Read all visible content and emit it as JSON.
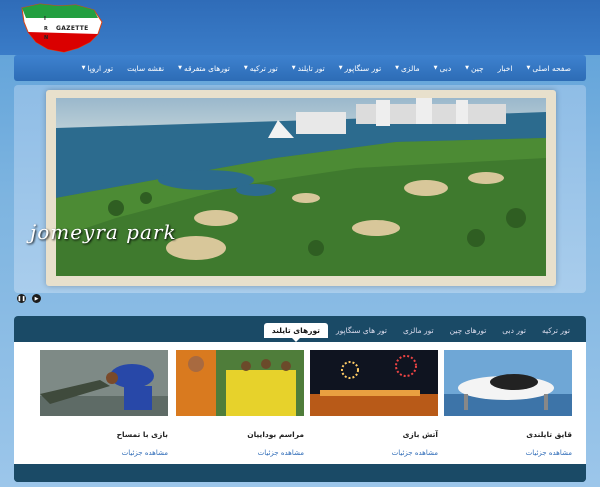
{
  "logo": {
    "text": "GAZETTE",
    "letters": [
      "I",
      "R",
      "N"
    ]
  },
  "nav": [
    {
      "label": "صفحه اصلی",
      "caret": true
    },
    {
      "label": "اخبار",
      "caret": false
    },
    {
      "label": "چین",
      "caret": true
    },
    {
      "label": "دبی",
      "caret": true
    },
    {
      "label": "مالزی",
      "caret": true
    },
    {
      "label": "تور سنگاپور",
      "caret": true
    },
    {
      "label": "تور تایلند",
      "caret": true
    },
    {
      "label": "تور ترکیه",
      "caret": true
    },
    {
      "label": "تورهای متفرقه",
      "caret": true
    },
    {
      "label": "نقشه سایت",
      "caret": false
    },
    {
      "label": "تور اروپا",
      "caret": true
    }
  ],
  "slider": {
    "caption": "jomeyra park",
    "controls": [
      "pause-icon",
      "play-icon"
    ]
  },
  "tabs": [
    {
      "label": "تور ترکیه",
      "active": false
    },
    {
      "label": "تور دبی",
      "active": false
    },
    {
      "label": "تورهای چین",
      "active": false
    },
    {
      "label": "تور مالزی",
      "active": false
    },
    {
      "label": "تور های سنگاپور",
      "active": false
    },
    {
      "label": "تورهای تایلند",
      "active": true
    }
  ],
  "cards": [
    {
      "title": "قایق تایلندی",
      "more": "مشاهده جزئیات"
    },
    {
      "title": "آتش بازی",
      "more": "مشاهده جزئیات"
    },
    {
      "title": "مراسم بوداییان",
      "more": "مشاهده جزئیات"
    },
    {
      "title": "بازی با تمساح",
      "more": "مشاهده جزئیات"
    }
  ],
  "colors": {
    "nav_bg": "#2d6cb6",
    "tab_box": "#1a4a66",
    "link": "#2f6cb8"
  }
}
